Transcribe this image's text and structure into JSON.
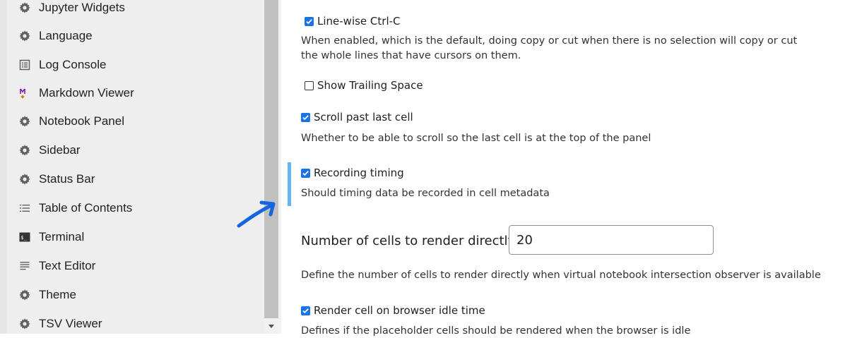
{
  "sidebar": {
    "items": [
      {
        "label": "Jupyter Widgets",
        "icon": "gear-icon"
      },
      {
        "label": "Language",
        "icon": "gear-icon"
      },
      {
        "label": "Log Console",
        "icon": "list-box-icon"
      },
      {
        "label": "Markdown Viewer",
        "icon": "markdown-icon"
      },
      {
        "label": "Notebook Panel",
        "icon": "gear-icon"
      },
      {
        "label": "Sidebar",
        "icon": "gear-icon"
      },
      {
        "label": "Status Bar",
        "icon": "gear-icon"
      },
      {
        "label": "Table of Contents",
        "icon": "toc-list-icon"
      },
      {
        "label": "Terminal",
        "icon": "terminal-icon"
      },
      {
        "label": "Text Editor",
        "icon": "text-lines-icon"
      },
      {
        "label": "Theme",
        "icon": "gear-icon"
      },
      {
        "label": "TSV Viewer",
        "icon": "gear-icon"
      }
    ]
  },
  "settings": {
    "linewise": {
      "label": "Line-wise Ctrl-C",
      "checked": true,
      "desc1": "When enabled, which is the default, doing copy or cut when there is no selection will copy or cut",
      "desc2": "the whole lines that have cursors on them."
    },
    "trailing": {
      "label": "Show Trailing Space",
      "checked": false
    },
    "scroll": {
      "label": "Scroll past last cell",
      "checked": true,
      "desc": "Whether to be able to scroll so the last cell is at the top of the panel"
    },
    "recording": {
      "label": "Recording timing",
      "checked": true,
      "desc": "Should timing data be recorded in cell metadata"
    },
    "cells": {
      "label": "Number of cells to render directly",
      "value": "20",
      "desc": "Define the number of cells to render directly when virtual notebook intersection observer is available"
    },
    "idle": {
      "label": "Render cell on browser idle time",
      "checked": true,
      "desc": "Defines if the placeholder cells should be rendered when the browser is idle"
    }
  },
  "colors": {
    "accent": "#1a73e8",
    "focus": "#64b5f6",
    "annotation": "#1565e0"
  }
}
